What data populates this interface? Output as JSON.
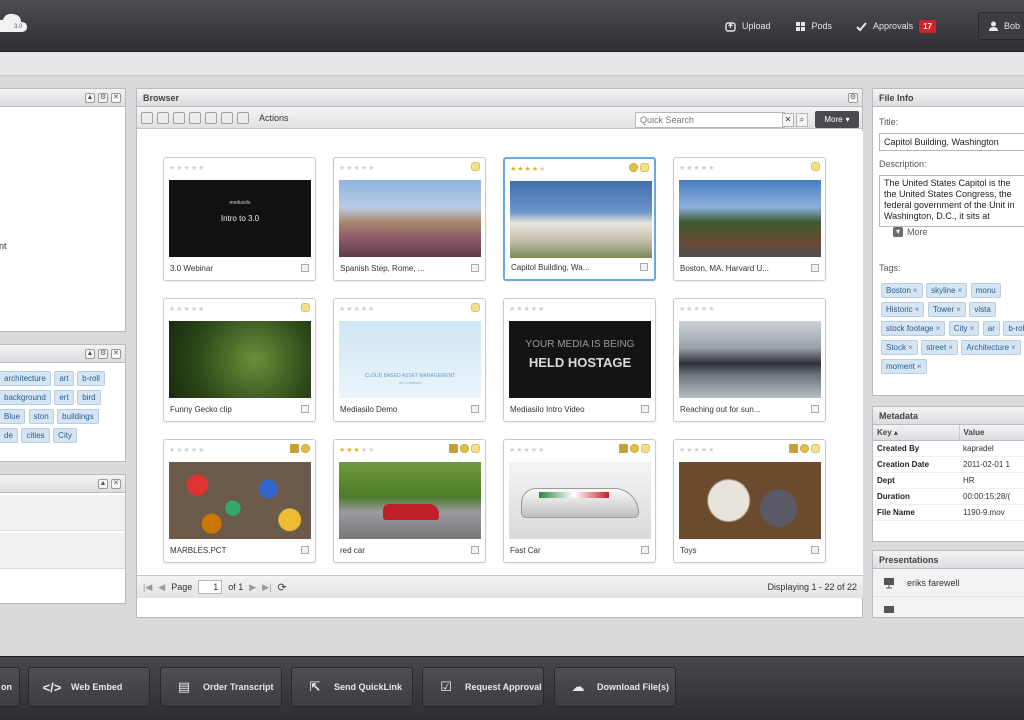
{
  "app": {
    "logo_version": "3.0"
  },
  "header": {
    "nav": [
      {
        "label": "Upload",
        "icon": "upload-icon"
      },
      {
        "label": "Pods",
        "icon": "grid-icon"
      },
      {
        "label": "Approvals",
        "icon": "check-icon",
        "badge": "17"
      }
    ],
    "user": "Bob"
  },
  "left": {
    "panel1_lines": [
      "nt"
    ],
    "tags": [
      "architecture",
      "art",
      "b-roll",
      "background",
      "ert",
      "bird",
      "Blue",
      "ston",
      "buildings",
      "de",
      "cities",
      "City"
    ]
  },
  "browser": {
    "title": "Browser",
    "actions_label": "Actions",
    "search_placeholder": "Quick Search",
    "more_label": "More",
    "assets": [
      {
        "caption": "3.0 Webinar",
        "stars": 0
      },
      {
        "caption": "Spanish Step, Rome, ...",
        "stars": 0
      },
      {
        "caption": "Capitol Building, Wa...",
        "stars": 4
      },
      {
        "caption": "Boston, MA. Harvard U...",
        "stars": 0
      },
      {
        "caption": "Funny Gecko clip",
        "stars": 0
      },
      {
        "caption": "Mediasilo Demo",
        "stars": 0
      },
      {
        "caption": "Mediasilo Intro Video",
        "stars": 0
      },
      {
        "caption": "Reaching out for sun...",
        "stars": 0
      },
      {
        "caption": "MARBLES.PCT",
        "stars": 0
      },
      {
        "caption": "red car",
        "stars": 3
      },
      {
        "caption": "Fast Car",
        "stars": 0
      },
      {
        "caption": "Toys",
        "stars": 0
      }
    ],
    "thumb_text": {
      "webinar_brand": "mediasilo",
      "webinar_title": "Intro to 3.0",
      "demo_line1": "CLOUD BASED ASSET MANAGEMENT",
      "demo_line2": "for Creatives",
      "intro_line1": "YOUR MEDIA IS BEING",
      "intro_line2": "HELD HOSTAGE"
    },
    "pager": {
      "page_label": "Page",
      "page": "1",
      "of_label": "of 1",
      "displaying": "Displaying 1 - 22 of 22"
    }
  },
  "file_info": {
    "title": "File Info",
    "title_label": "Title:",
    "title_value": "Capitol Building, Washington",
    "description_label": "Description:",
    "description": "The United States Capitol is the the United States Congress, the federal government of the Unit in Washington, D.C., it sits at",
    "more_label": "More",
    "tags_label": "Tags:",
    "tags": [
      "Boston",
      "skyline",
      "monu",
      "Historic",
      "Tower",
      "vista",
      "stock footage",
      "City",
      "ar",
      "b-roll",
      "Stock",
      "street",
      "Architecture",
      "moment"
    ]
  },
  "metadata": {
    "title": "Metadata",
    "columns": [
      "Key",
      "Value"
    ],
    "rows": [
      [
        "Created By",
        "kapradel"
      ],
      [
        "Creation Date",
        "2011-02-01 1"
      ],
      [
        "Dept",
        "HR"
      ],
      [
        "Duration",
        "00:00:15;28/("
      ],
      [
        "File Name",
        "1190-9.mov"
      ]
    ]
  },
  "presentations": {
    "title": "Presentations",
    "items": [
      "eriks farewell"
    ]
  },
  "bottom_actions": [
    {
      "label": "on",
      "icon": "share-icon"
    },
    {
      "label": "Web Embed",
      "icon": "code-icon"
    },
    {
      "label": "Order Transcript",
      "icon": "document-icon"
    },
    {
      "label": "Send QuickLink",
      "icon": "send-icon"
    },
    {
      "label": "Request Approval",
      "icon": "approval-icon"
    },
    {
      "label": "Download File(s)",
      "icon": "download-icon"
    }
  ]
}
